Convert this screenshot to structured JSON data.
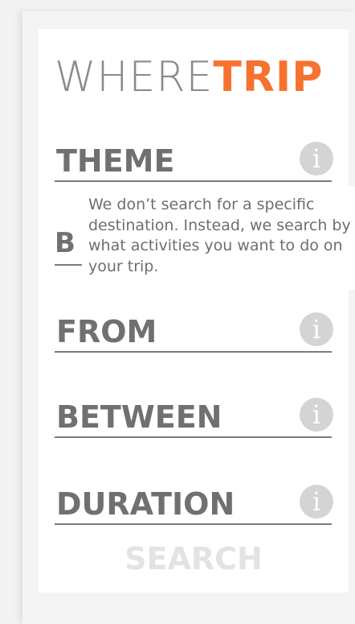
{
  "logo": {
    "part1": "WHERE",
    "part2": "TRIP"
  },
  "fields": {
    "theme": {
      "label": "THEME",
      "info_icon": "info-icon",
      "info_glyph": "i"
    },
    "from": {
      "label": "FROM",
      "info_icon": "info-icon",
      "info_glyph": "i"
    },
    "between": {
      "label": "BETWEEN",
      "info_icon": "info-icon",
      "info_glyph": "i"
    },
    "duration": {
      "label": "DURATION",
      "info_icon": "info-icon",
      "info_glyph": "i"
    }
  },
  "tooltip": {
    "underlying_label_fragment": "B",
    "text": "We don’t search for a specific destination. Instead, we search by what activities you want to do on your trip."
  },
  "search": {
    "label": "SEARCH"
  },
  "colors": {
    "accent": "#f7712f",
    "text": "#707070",
    "info_bg": "#d4d4d4",
    "search_disabled": "#e3e3e3"
  }
}
